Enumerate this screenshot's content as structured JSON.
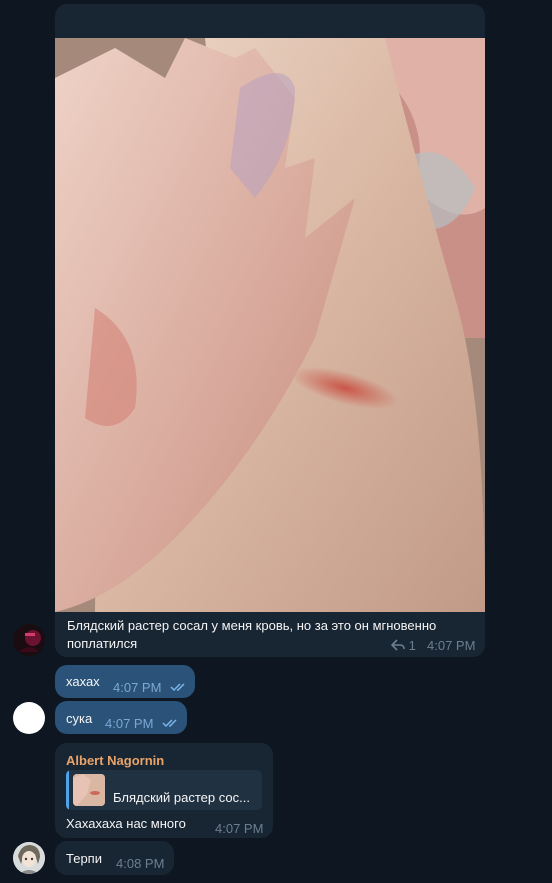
{
  "messages": {
    "photo": {
      "forward_icon": "",
      "caption": "Блядский растер сосал у меня кровь, но за это он мгновенно поплатился",
      "reply_count": "1",
      "time": "4:07 PM"
    },
    "out1": {
      "text": "хахах",
      "time": "4:07 PM"
    },
    "out2": {
      "text": "сука",
      "time": "4:07 PM"
    },
    "reply_msg": {
      "sender": "Albert Nagornin",
      "quote_icon": "",
      "quote_text": "Блядский растер сос...",
      "text": "Хахахаха нас много",
      "time": "4:07 PM"
    },
    "last": {
      "text": "Терпи",
      "time": "4:08 PM"
    }
  },
  "colors": {
    "background": "#0e1621",
    "incoming_bubble": "#182533",
    "outgoing_bubble": "#2b5278",
    "sender_name": "#e9a46a",
    "accent": "#64b5ef"
  },
  "icons": [
    "forward-icon",
    "reply-arrow-icon",
    "double-check-icon",
    "photo-thumbnail",
    "avatar"
  ]
}
